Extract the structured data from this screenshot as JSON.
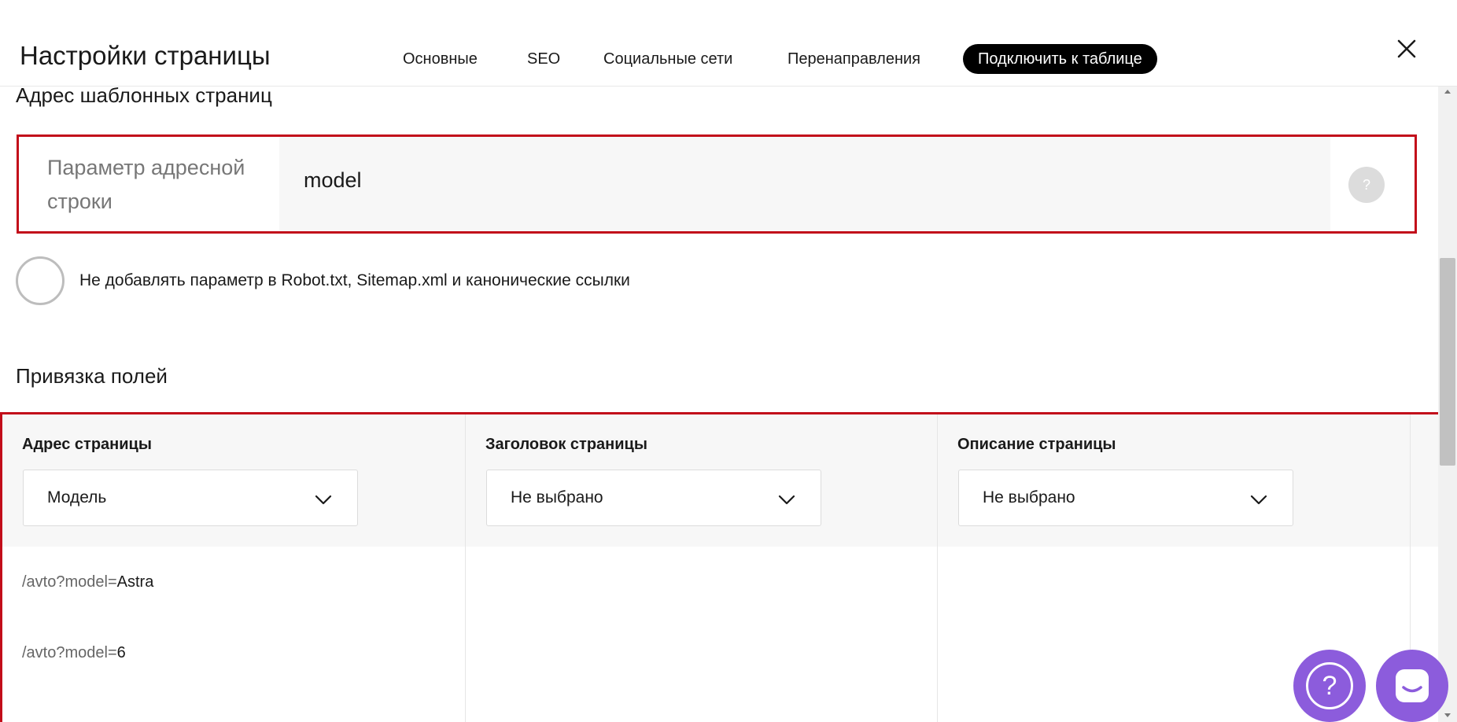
{
  "header": {
    "title": "Настройки страницы",
    "tabs": [
      {
        "label": "Основные"
      },
      {
        "label": "SEO"
      },
      {
        "label": "Социальные сети"
      },
      {
        "label": "Перенаправления"
      },
      {
        "label": "Подключить к таблице",
        "active": true
      }
    ],
    "close_icon": "close-icon"
  },
  "template_address": {
    "section_title": "Адрес шаблонных страниц",
    "param_label": "Параметр адресной строки",
    "param_value": "model",
    "help_symbol": "?"
  },
  "checkbox": {
    "label": "Не добавлять параметр в Robot.txt, Sitemap.xml и канонические ссылки",
    "checked": false
  },
  "binding": {
    "section_title": "Привязка полей",
    "columns": [
      {
        "title": "Адрес страницы",
        "selected": "Модель"
      },
      {
        "title": "Заголовок страницы",
        "selected": "Не выбрано"
      },
      {
        "title": "Описание страницы",
        "selected": "Не выбрано"
      }
    ],
    "rows": [
      {
        "prefix": "/avto?model=",
        "value": "Astra"
      },
      {
        "prefix": "/avto?model=",
        "value": "6"
      }
    ]
  },
  "fabs": {
    "help_symbol": "?",
    "help_icon": "help-circle-icon",
    "chat_icon": "chat-icon"
  },
  "colors": {
    "accent_purple": "#8c5cdc",
    "highlight_red": "#c20d1a",
    "active_tab_bg": "#000000"
  }
}
